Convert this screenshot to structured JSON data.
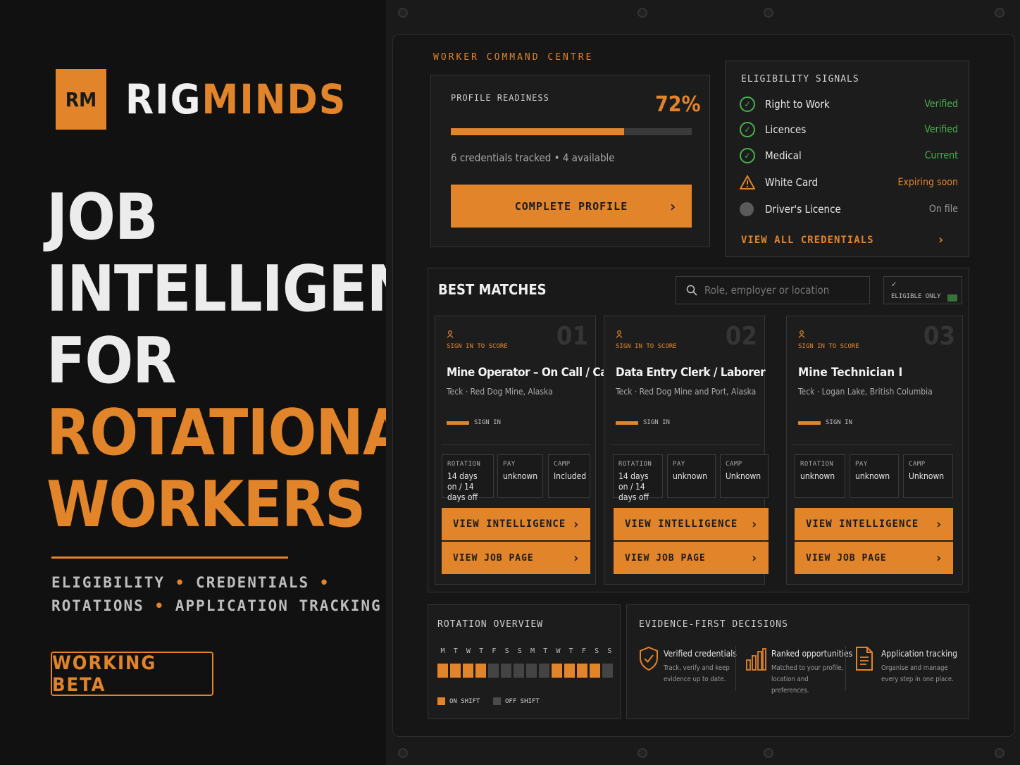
{
  "brand": {
    "logo_initials": "RM",
    "name_part1": "RIG",
    "name_part2": "MINDS"
  },
  "hero": {
    "lines": [
      {
        "text": "JOB",
        "accent": false
      },
      {
        "text": "INTELLIGENCE",
        "accent": false
      },
      {
        "text": "FOR",
        "accent": false
      },
      {
        "text": "ROTATIONAL",
        "accent": true
      },
      {
        "text": "WORKERS",
        "accent": true
      }
    ],
    "tagline_line1": [
      "ELIGIBILITY",
      "CREDENTIALS"
    ],
    "tagline_line2": [
      "ROTATIONS",
      "APPLICATION TRACKING"
    ],
    "beta_label": "WORKING BETA"
  },
  "dashboard": {
    "section_title": "WORKER COMMAND CENTRE",
    "readiness": {
      "label": "PROFILE READINESS",
      "percent_text": "72%",
      "percent_value": 72,
      "summary": "6 credentials tracked • 4 available",
      "cta": "COMPLETE PROFILE"
    },
    "eligibility": {
      "title": "ELIGIBILITY SIGNALS",
      "items": [
        {
          "name": "Right to Work",
          "status": "Verified",
          "icon": "check-circle-icon",
          "color": "#48b14c"
        },
        {
          "name": "Licences",
          "status": "Verified",
          "icon": "check-circle-icon",
          "color": "#48b14c"
        },
        {
          "name": "Medical",
          "status": "Current",
          "icon": "check-circle-icon",
          "color": "#48b14c"
        },
        {
          "name": "White Card",
          "status": "Expiring soon",
          "icon": "warning-icon",
          "color": "#e2842a"
        },
        {
          "name": "Driver's Licence",
          "status": "On file",
          "icon": "grey-dot-icon",
          "color": "#9a9a9a"
        }
      ],
      "view_all": "VIEW ALL CREDENTIALS"
    },
    "matches": {
      "title": "BEST MATCHES",
      "search_placeholder": "Role, employer or location",
      "filter_label": "ELIGIBLE ONLY",
      "jobs": [
        {
          "rank": "01",
          "score_label": "SIGN IN TO SCORE",
          "title": "Mine Operator – On Call / Casual",
          "meta": "Teck · Red Dog Mine, Alaska",
          "sign_in": "SIGN IN",
          "rotation_label": "ROTATION",
          "rotation_value": "14 days on / 14 days off",
          "pay_label": "PAY",
          "pay_value": "unknown",
          "camp_label": "CAMP",
          "camp_value": "Included",
          "btn_intel": "VIEW INTELLIGENCE",
          "btn_job": "VIEW JOB PAGE"
        },
        {
          "rank": "02",
          "score_label": "SIGN IN TO SCORE",
          "title": "Data Entry Clerk / Laborer",
          "meta": "Teck · Red Dog Mine and Port, Alaska",
          "sign_in": "SIGN IN",
          "rotation_label": "ROTATION",
          "rotation_value": "14 days on / 14 days off",
          "pay_label": "PAY",
          "pay_value": "unknown",
          "camp_label": "CAMP",
          "camp_value": "Unknown",
          "btn_intel": "VIEW INTELLIGENCE",
          "btn_job": "VIEW JOB PAGE"
        },
        {
          "rank": "03",
          "score_label": "SIGN IN TO SCORE",
          "title": "Mine Technician I",
          "meta": "Teck · Logan Lake, British Columbia",
          "sign_in": "SIGN IN",
          "rotation_label": "ROTATION",
          "rotation_value": "unknown",
          "pay_label": "PAY",
          "pay_value": "unknown",
          "camp_label": "CAMP",
          "camp_value": "Unknown",
          "btn_intel": "VIEW INTELLIGENCE",
          "btn_job": "VIEW JOB PAGE"
        }
      ]
    },
    "rotation": {
      "title": "ROTATION OVERVIEW",
      "days": [
        "M",
        "T",
        "W",
        "T",
        "F",
        "S",
        "S",
        "M",
        "T",
        "W",
        "T",
        "F",
        "S",
        "S"
      ],
      "on_shift": [
        true,
        true,
        true,
        true,
        false,
        false,
        false,
        false,
        false,
        true,
        true,
        true,
        true,
        false
      ],
      "legend_on": "ON SHIFT",
      "legend_off": "OFF SHIFT"
    },
    "evidence": {
      "title": "EVIDENCE-FIRST DECISIONS",
      "items": [
        {
          "icon": "shield-check-icon",
          "title": "Verified credentials",
          "desc": "Track, verify and keep evidence up to date."
        },
        {
          "icon": "bar-chart-icon",
          "title": "Ranked opportunities",
          "desc": "Matched to your profile, location and preferences."
        },
        {
          "icon": "document-icon",
          "title": "Application tracking",
          "desc": "Organise and manage every step in one place."
        }
      ]
    },
    "colors": {
      "accent": "#e2842a",
      "ok": "#48b14c",
      "muted": "#9a9a9a"
    }
  }
}
